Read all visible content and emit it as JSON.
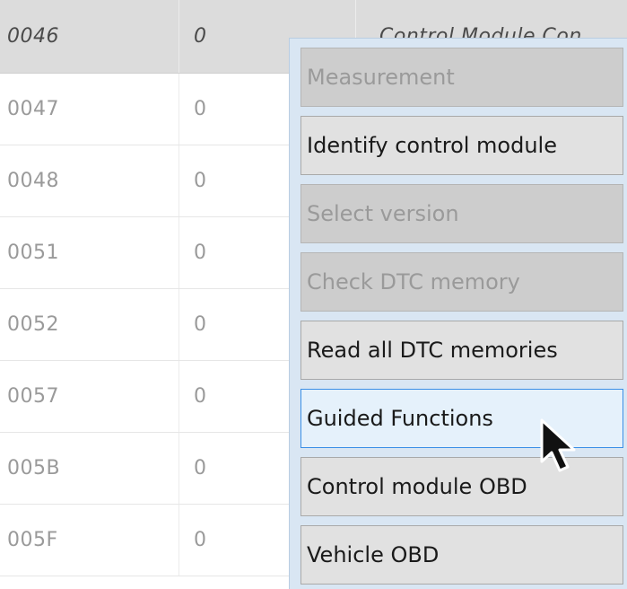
{
  "grid": {
    "header": {
      "id": "0046",
      "value": "0",
      "description": "Control Module Con"
    },
    "rows": [
      {
        "id": "0047",
        "value": "0"
      },
      {
        "id": "0048",
        "value": "0"
      },
      {
        "id": "0051",
        "value": "0"
      },
      {
        "id": "0052",
        "value": "0"
      },
      {
        "id": "0057",
        "value": "0"
      },
      {
        "id": "005B",
        "value": "0"
      },
      {
        "id": "005F",
        "value": "0"
      }
    ]
  },
  "context_menu": {
    "items": [
      {
        "label": "Measurement",
        "state": "disabled"
      },
      {
        "label": "Identify control module",
        "state": "enabled"
      },
      {
        "label": "Select version",
        "state": "disabled"
      },
      {
        "label": "Check DTC memory",
        "state": "disabled"
      },
      {
        "label": "Read all DTC memories",
        "state": "enabled"
      },
      {
        "label": "Guided Functions",
        "state": "hover"
      },
      {
        "label": "Control module OBD",
        "state": "enabled"
      },
      {
        "label": "Vehicle OBD",
        "state": "enabled"
      }
    ]
  },
  "cursor": {
    "icon": "arrow-pointer-icon"
  },
  "colors": {
    "menu_background": "#d9e6f3",
    "hover_border": "#3a8ee6",
    "hover_background": "#e5f1fb",
    "disabled_background": "#cdcdcd",
    "header_background": "#dcdcdc"
  }
}
